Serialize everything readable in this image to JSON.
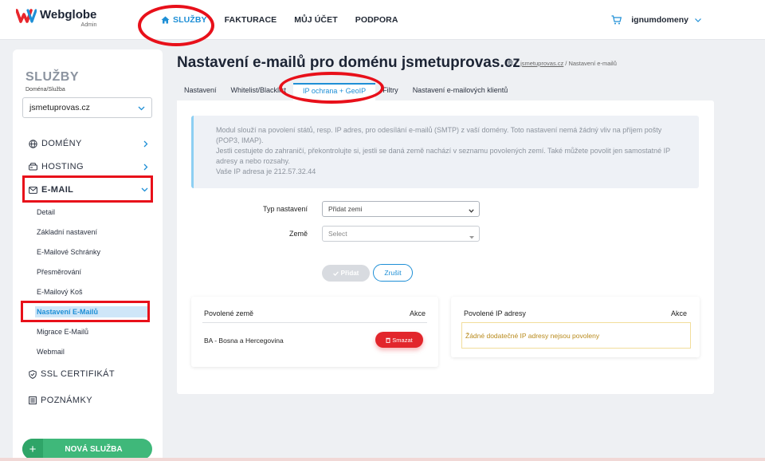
{
  "brand": {
    "name": "Webglobe",
    "sub": "Admin"
  },
  "topnav": [
    {
      "label": "SLUŽBY",
      "active": true
    },
    {
      "label": "FAKTURACE"
    },
    {
      "label": "MŮJ ÚČET"
    },
    {
      "label": "PODPORA"
    }
  ],
  "user": {
    "name": "ignumdomeny"
  },
  "sidebar": {
    "title": "SLUŽBY",
    "domain_label": "Doména/Služba",
    "domain_value": "jsmetuprovas.cz",
    "menu": [
      {
        "label": "DOMÉNY",
        "icon": "globe-icon"
      },
      {
        "label": "HOSTING",
        "icon": "server-icon"
      },
      {
        "label": "E-MAIL",
        "icon": "mail-icon"
      }
    ],
    "email_items": [
      "Detail",
      "Základní nastavení",
      "E-Mailové Schránky",
      "Přesměrování",
      "E-Mailový Koš",
      "Nastavení E-Mailů",
      "Migrace E-Mailů",
      "Webmail"
    ],
    "ssl": "SSL CERTIFIKÁT",
    "notes": "POZNÁMKY",
    "new_service": "NOVÁ SLUŽBA"
  },
  "page": {
    "title": "Nastavení e-mailů pro doménu jsmetuprovas.cz",
    "breadcrumb": {
      "link": "jsmetuprovas.cz",
      "current": "Nastavení e-mailů"
    }
  },
  "tabs": [
    "Nastavení",
    "Whitelist/Blacklist",
    "IP ochrana + GeoIP",
    "Filtry",
    "Nastavení e-mailových klientů"
  ],
  "info": {
    "line1": "Modul slouží na povolení států, resp. IP adres, pro odesílání e-mailů (SMTP) z vaší domény. Toto nastavení nemá žádný vliv na příjem pošty (POP3, IMAP).",
    "line2": "Jestli cestujete do zahraničí, překontrolujte si, jestli se daná země nachází v seznamu povolených zemí. Také můžete povolit jen samostatné IP adresy a nebo rozsahy.",
    "line3": "Vaše IP adresa je 212.57.32.44"
  },
  "form": {
    "type_label": "Typ nastavení",
    "type_value": "Přidat zemi",
    "country_label": "Země",
    "country_placeholder": "Select",
    "add": "Přidat",
    "cancel": "Zrušit"
  },
  "countries_card": {
    "header": "Povolené země",
    "action": "Akce",
    "rows": [
      {
        "name": "BA - Bosna a Hercegovina",
        "delete": "Smazat"
      }
    ]
  },
  "ips_card": {
    "header": "Povolené IP adresy",
    "action": "Akce",
    "empty": "Žádné dodatečné IP adresy nejsou povoleny"
  },
  "colors": {
    "accent": "#1e8fd6",
    "danger": "#e2262c",
    "success": "#3fb87a",
    "annotation": "#e8101a"
  }
}
